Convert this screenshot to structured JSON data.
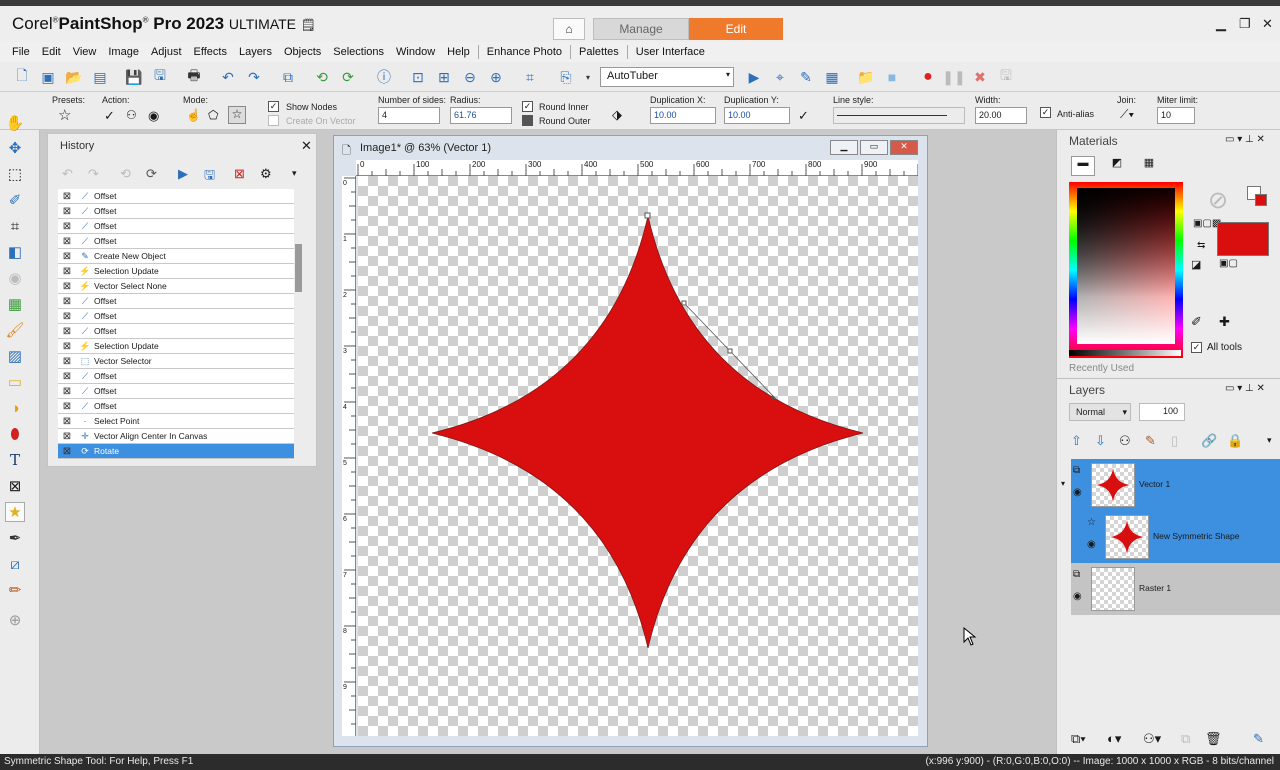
{
  "app": {
    "brand": "Corel",
    "product": "PaintShop",
    "pro": "Pro 2023",
    "edition": "ULTIMATE"
  },
  "workspace_tabs": {
    "manage": "Manage",
    "edit": "Edit"
  },
  "menu": [
    "File",
    "Edit",
    "View",
    "Image",
    "Adjust",
    "Effects",
    "Layers",
    "Objects",
    "Selections",
    "Window",
    "Help",
    "Enhance Photo",
    "Palettes",
    "User Interface"
  ],
  "toolbar": {
    "script": "AutoTuber"
  },
  "options": {
    "presets_label": "Presets:",
    "action_label": "Action:",
    "mode_label": "Mode:",
    "show_nodes": "Show Nodes",
    "create_on_vector": "Create On Vector",
    "sides_label": "Number of sides:",
    "sides_value": "4",
    "radius_label": "Radius:",
    "radius_value": "61.76",
    "round_inner": "Round Inner",
    "round_outer": "Round Outer",
    "dupx_label": "Duplication X:",
    "dupx_value": "10.00",
    "dupy_label": "Duplication Y:",
    "dupy_value": "10.00",
    "linestyle_label": "Line style:",
    "width_label": "Width:",
    "width_value": "20.00",
    "antialias": "Anti-alias",
    "join_label": "Join:",
    "miter_label": "Miter limit:",
    "miter_value": "10"
  },
  "history": {
    "title": "History",
    "items": [
      {
        "label": "Offset",
        "icon": "offset-icon"
      },
      {
        "label": "Offset",
        "icon": "offset-icon"
      },
      {
        "label": "Offset",
        "icon": "offset-icon"
      },
      {
        "label": "Offset",
        "icon": "offset-icon"
      },
      {
        "label": "Create New Object",
        "icon": "pen-icon"
      },
      {
        "label": "Selection Update",
        "icon": "lightning-icon"
      },
      {
        "label": "Vector Select None",
        "icon": "lightning-icon"
      },
      {
        "label": "Offset",
        "icon": "offset-icon"
      },
      {
        "label": "Offset",
        "icon": "offset-icon"
      },
      {
        "label": "Offset",
        "icon": "offset-icon"
      },
      {
        "label": "Selection Update",
        "icon": "lightning-icon"
      },
      {
        "label": "Vector Selector",
        "icon": "selector-icon"
      },
      {
        "label": "Offset",
        "icon": "offset-icon"
      },
      {
        "label": "Offset",
        "icon": "offset-icon"
      },
      {
        "label": "Offset",
        "icon": "offset-icon"
      },
      {
        "label": "Select Point",
        "icon": "point-icon"
      },
      {
        "label": "Vector Align Center In Canvas",
        "icon": "align-icon"
      },
      {
        "label": "Rotate",
        "icon": "rotate-icon",
        "selected": true
      }
    ]
  },
  "image_window": {
    "title": "Image1* @  63% (Vector 1)",
    "ruler_h": [
      "0",
      "100",
      "200",
      "300",
      "400",
      "500",
      "600",
      "700",
      "800",
      "900"
    ],
    "ruler_v": [
      "0",
      "1",
      "2",
      "3",
      "4",
      "5",
      "6",
      "7",
      "8",
      "9"
    ],
    "shape_color": "#d90e0e"
  },
  "materials": {
    "title": "Materials",
    "all_tools": "All tools",
    "recently_used": "Recently Used",
    "foreground": "#ffffff",
    "background": "#d90e0e"
  },
  "layers": {
    "title": "Layers",
    "blend_mode": "Normal",
    "opacity": "100",
    "items": [
      {
        "name": "Vector 1",
        "selected": true
      },
      {
        "name": "New Symmetric Shape",
        "selected": true
      },
      {
        "name": "Raster 1",
        "selected": false
      }
    ]
  },
  "status": {
    "left": "Symmetric Shape Tool: For Help, Press F1",
    "right": "(x:996 y:900) - (R:0,G:0,B:0,O:0) -- Image:  1000 x 1000 x RGB - 8 bits/channel"
  }
}
